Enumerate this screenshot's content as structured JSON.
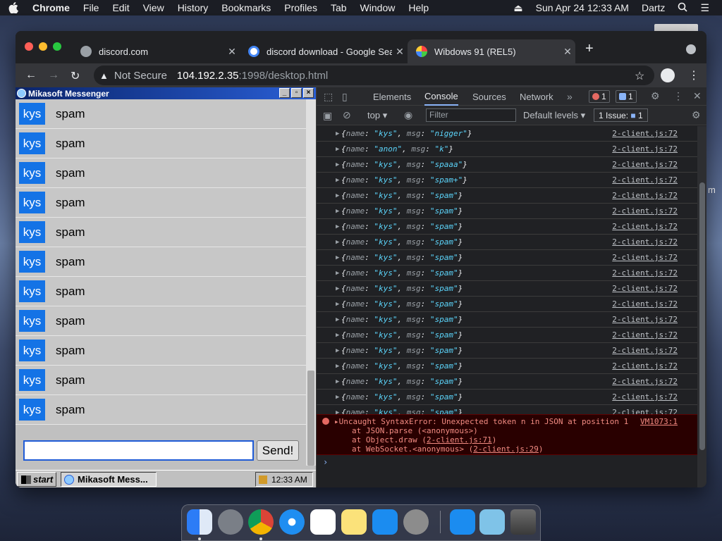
{
  "menubar": {
    "app": "Chrome",
    "items": [
      "File",
      "Edit",
      "View",
      "History",
      "Bookmarks",
      "Profiles",
      "Tab",
      "Window",
      "Help"
    ],
    "datetime": "Sun Apr 24  12:33 AM",
    "user": "Dartz"
  },
  "tabs": [
    {
      "title": "discord.com",
      "color": "#9aa0a6"
    },
    {
      "title": "discord download - Google Sea",
      "color": "#ffffff"
    },
    {
      "title": "Wibdows 91 (REL5)",
      "color": "#4a7fd6"
    }
  ],
  "address": {
    "security": "Not Secure",
    "host": "104.192.2.35",
    "path": ":1998/desktop.html"
  },
  "messenger": {
    "title": "Mikasoft Messenger",
    "messages": [
      {
        "name": "kys",
        "text": "spam"
      },
      {
        "name": "kys",
        "text": "spam"
      },
      {
        "name": "kys",
        "text": "spam"
      },
      {
        "name": "kys",
        "text": "spam"
      },
      {
        "name": "kys",
        "text": "spam"
      },
      {
        "name": "kys",
        "text": "spam"
      },
      {
        "name": "kys",
        "text": "spam"
      },
      {
        "name": "kys",
        "text": "spam"
      },
      {
        "name": "kys",
        "text": "spam"
      },
      {
        "name": "kys",
        "text": "spam"
      },
      {
        "name": "kys",
        "text": "spam"
      }
    ],
    "input_value": "",
    "send_label": "Send!",
    "start_label": "start",
    "task_label": "Mikasoft Mess...",
    "clock": "12:33 AM"
  },
  "devtools": {
    "tabs": [
      "Elements",
      "Console",
      "Sources",
      "Network"
    ],
    "active_tab": "Console",
    "error_count": "1",
    "message_count": "1",
    "context": "top",
    "filter_placeholder": "Filter",
    "levels": "Default levels",
    "issues_label": "1 Issue:",
    "issues_count": "1",
    "logs": [
      {
        "name": "\"kys\"",
        "msg": "\"nigger\"",
        "src": "2-client.js:72"
      },
      {
        "name": "\"anon\"",
        "msg": "\"k\"",
        "src": "2-client.js:72"
      },
      {
        "name": "\"kys\"",
        "msg": "\"spaaa\"",
        "src": "2-client.js:72"
      },
      {
        "name": "\"kys\"",
        "msg": "\"spam+\"",
        "src": "2-client.js:72"
      },
      {
        "name": "\"kys\"",
        "msg": "\"spam\"",
        "src": "2-client.js:72"
      },
      {
        "name": "\"kys\"",
        "msg": "\"spam\"",
        "src": "2-client.js:72"
      },
      {
        "name": "\"kys\"",
        "msg": "\"spam\"",
        "src": "2-client.js:72"
      },
      {
        "name": "\"kys\"",
        "msg": "\"spam\"",
        "src": "2-client.js:72"
      },
      {
        "name": "\"kys\"",
        "msg": "\"spam\"",
        "src": "2-client.js:72"
      },
      {
        "name": "\"kys\"",
        "msg": "\"spam\"",
        "src": "2-client.js:72"
      },
      {
        "name": "\"kys\"",
        "msg": "\"spam\"",
        "src": "2-client.js:72"
      },
      {
        "name": "\"kys\"",
        "msg": "\"spam\"",
        "src": "2-client.js:72"
      },
      {
        "name": "\"kys\"",
        "msg": "\"spam\"",
        "src": "2-client.js:72"
      },
      {
        "name": "\"kys\"",
        "msg": "\"spam\"",
        "src": "2-client.js:72"
      },
      {
        "name": "\"kys\"",
        "msg": "\"spam\"",
        "src": "2-client.js:72"
      },
      {
        "name": "\"kys\"",
        "msg": "\"spam\"",
        "src": "2-client.js:72"
      },
      {
        "name": "\"kys\"",
        "msg": "\"spam\"",
        "src": "2-client.js:72"
      },
      {
        "name": "\"kys\"",
        "msg": "\"spam\"",
        "src": "2-client.js:72"
      },
      {
        "name": "\"kys\"",
        "msg": "\"spam\"",
        "src": "2-client.js:72"
      }
    ],
    "error": {
      "line1": "Uncaught SyntaxError: Unexpected token n in JSON at position 1",
      "line2": "at JSON.parse (<anonymous>)",
      "line3a": "at Object.draw (",
      "line3b": "2-client.js:71",
      "line3c": ")",
      "line4a": "at WebSocket.<anonymous> (",
      "line4b": "2-client.js:29",
      "line4c": ")",
      "src": "VM1073:1"
    }
  }
}
